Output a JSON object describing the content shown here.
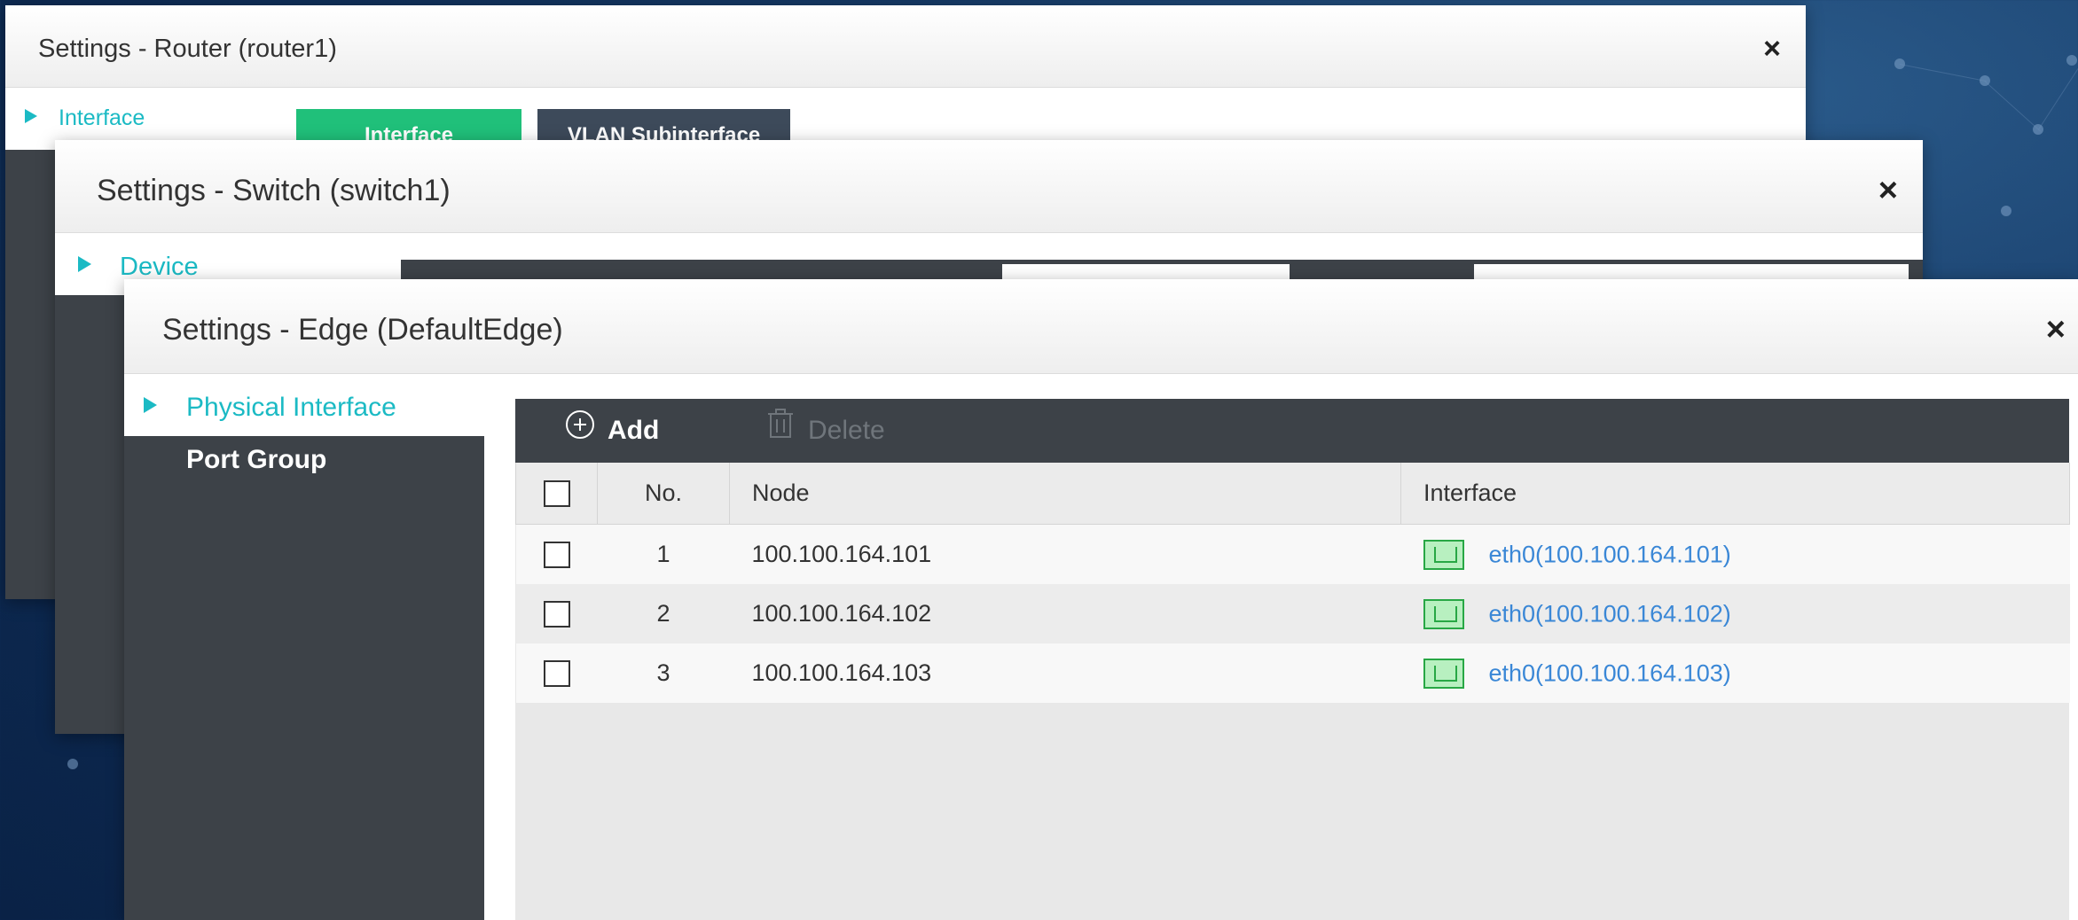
{
  "router_window": {
    "title": "Settings - Router (router1)",
    "close_glyph": "×",
    "sidebar_active": "Interface",
    "tabs": [
      {
        "label": "Interface",
        "color": "#20c07a"
      },
      {
        "label": "VLAN Subinterface",
        "color": "#3d4a5a"
      }
    ]
  },
  "switch_window": {
    "title": "Settings - Switch (switch1)",
    "close_glyph": "×",
    "sidebar_active": "Device"
  },
  "edge_window": {
    "title": "Settings - Edge (DefaultEdge)",
    "close_glyph": "×",
    "sidebar": [
      {
        "label": "Physical Interface",
        "active": true
      },
      {
        "label": "Port Group",
        "active": false
      }
    ],
    "toolbar": {
      "add_label": "Add",
      "delete_label": "Delete",
      "add_icon": "plus-circle-icon",
      "delete_icon": "trash-icon"
    },
    "table": {
      "headers": {
        "no": "No.",
        "node": "Node",
        "interface": "Interface"
      },
      "rows": [
        {
          "no": "1",
          "node": "100.100.164.101",
          "interface": "eth0(100.100.164.101)"
        },
        {
          "no": "2",
          "node": "100.100.164.102",
          "interface": "eth0(100.100.164.102)"
        },
        {
          "no": "3",
          "node": "100.100.164.103",
          "interface": "eth0(100.100.164.103)"
        }
      ]
    }
  },
  "colors": {
    "accent": "#1bbac4",
    "sidebar_bg": "#3d4248",
    "link": "#3a87d6",
    "port_icon": "#28a745"
  }
}
